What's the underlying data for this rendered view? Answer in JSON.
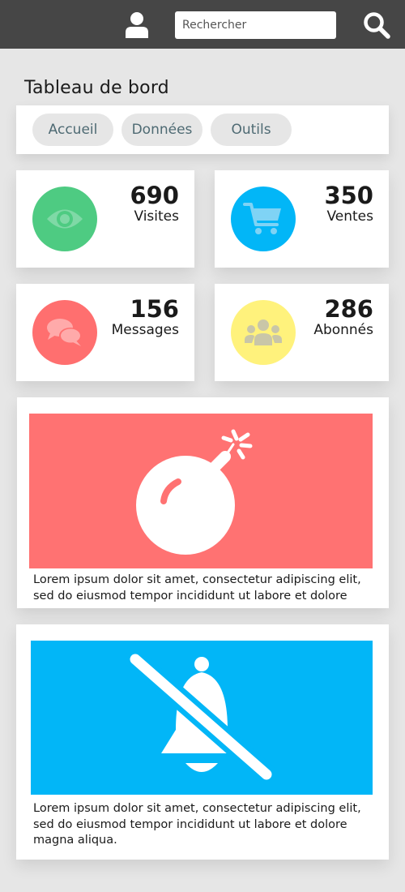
{
  "header": {
    "search": {
      "placeholder": "Rechercher",
      "value": ""
    },
    "icons": {
      "user": "user-icon",
      "search": "search-icon"
    }
  },
  "page": {
    "title": "Tableau de bord"
  },
  "tabs": [
    {
      "label": "Accueil"
    },
    {
      "label": "Données"
    },
    {
      "label": "Outils"
    }
  ],
  "stats": [
    {
      "value": "690",
      "label": "Visites",
      "icon": "eye-icon",
      "color": "#4ecb82"
    },
    {
      "value": "350",
      "label": "Ventes",
      "icon": "cart-icon",
      "color": "#02b6f7"
    },
    {
      "value": "156",
      "label": "Messages",
      "icon": "chat-icon",
      "color": "#ff6f6f"
    },
    {
      "value": "286",
      "label": "Abonnés",
      "icon": "group-icon",
      "color": "#fff27c"
    }
  ],
  "cards": [
    {
      "icon": "bomb-icon",
      "color": "#ff7272",
      "text": "Lorem ipsum dolor sit amet, consectetur adipiscing elit, sed do eiusmod tempor incididunt ut labore et dolore"
    },
    {
      "icon": "bell-slash-icon",
      "color": "#02b6f7",
      "text": "Lorem ipsum dolor sit amet, consectetur adipiscing elit, sed do eiusmod tempor incididunt ut labore et dolore magna aliqua."
    }
  ],
  "colors": {
    "topbar": "#464646",
    "background": "#e6e6e6",
    "tab_text": "#4e6a73"
  }
}
